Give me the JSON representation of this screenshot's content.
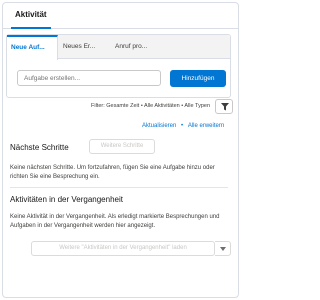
{
  "tabs": {
    "main": "Aktivität"
  },
  "composer": {
    "tabs": [
      "Neue Auf...",
      "Neues Er...",
      "Anruf pro..."
    ],
    "input_placeholder": "Aufgabe erstellen...",
    "add_button": "Hinzufügen"
  },
  "filter": {
    "text": "Filter: Gesamte Zeit • Alle Aktivitäten • Alle Typen",
    "icon": "funnel-icon"
  },
  "links": {
    "refresh": "Aktualisieren",
    "expand_all": "Alle erweitern"
  },
  "next_steps": {
    "title": "Nächste Schritte",
    "more_button": "Weitere Schritte",
    "empty_text": "Keine nächsten Schritte. Um fortzufahren, fügen Sie eine Aufgabe hinzu oder richten Sie eine Besprechung ein."
  },
  "past_activities": {
    "title": "Aktivitäten in der Vergangenheit",
    "empty_text": "Keine Aktivität in der Vergangenheit. Als erledigt markierte Besprechungen und Aufgaben in der Vergangenheit werden hier angezeigt.",
    "load_button": "Weitere \"Aktivitäten in der Vergangenheit\" laden",
    "menu_icon": "chevron-down-icon"
  },
  "colors": {
    "brand": "#0176d3",
    "border": "#d8dde6"
  }
}
